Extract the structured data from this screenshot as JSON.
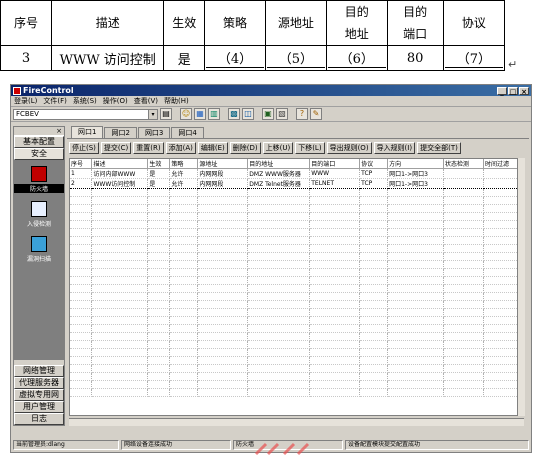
{
  "question_table": {
    "headers": [
      "序号",
      "描述",
      "生效",
      "策略",
      "源地址",
      "目的\n地址",
      "目的\n端口",
      "协议"
    ],
    "row": [
      "3",
      "WWW 访问控制",
      "是",
      "（4）",
      "（5）",
      "（6）",
      "80",
      "（7）"
    ]
  },
  "window": {
    "title": "FireControl",
    "controls": [
      "_",
      "□",
      "×"
    ],
    "menu": [
      "登录(L)",
      "文件(F)",
      "系统(S)",
      "操作(O)",
      "查看(V)",
      "帮助(H)"
    ],
    "combo_value": "FCBEV",
    "left_close": "×",
    "left_top_buttons": [
      "基本配置",
      "安全"
    ],
    "left_icons": [
      {
        "label": "防火墙",
        "icon": "firewall-icon",
        "color": "#c00000"
      },
      {
        "label": "入侵检测",
        "icon": "intrusion-detection-icon",
        "color": "#ffffff"
      },
      {
        "label": "漏洞扫描",
        "icon": "vulnerability-scan-icon",
        "color": "#3aa0d8"
      }
    ],
    "left_bottom_buttons": [
      "网络管理",
      "代理服务器",
      "虚拟专用网",
      "用户管理",
      "日志"
    ],
    "tabs": [
      "网口1",
      "网口2",
      "网口3",
      "网口4"
    ],
    "actions": [
      "停止(S)",
      "提交(C)",
      "重置(R)",
      "添加(A)",
      "编辑(E)",
      "删除(D)",
      "上移(U)",
      "下移(L)",
      "导出规则(O)",
      "导入规则(I)",
      "提交全部(T)"
    ],
    "columns": [
      "序号",
      "描述",
      "生效",
      "策略",
      "源地址",
      "目的地址",
      "目的端口",
      "协议",
      "方向",
      "状态检测",
      "时间过滤"
    ],
    "rows": [
      [
        "1",
        "访问内部WWW",
        "是",
        "允许",
        "内网网段",
        "DMZ WWW服务器",
        "WWW",
        "TCP",
        "网口1->网口3",
        "",
        ""
      ],
      [
        "2",
        "WWW访问控制",
        "是",
        "允许",
        "内网网段",
        "DMZ Telnet服务器",
        "TELNET",
        "TCP",
        "网口1->网口3",
        "",
        ""
      ]
    ],
    "status": [
      "当前管理员:dlang",
      "网络设备连接成功",
      "防火墙",
      "设备配置模块提交配置成功"
    ]
  },
  "icons": {
    "toolbar": [
      "dropdown-icon",
      "layout-icon",
      "user-icon",
      "chart-icon",
      "table-icon",
      "grid-icon",
      "network-icon",
      "config-icon",
      "print-icon",
      "help-icon"
    ]
  }
}
